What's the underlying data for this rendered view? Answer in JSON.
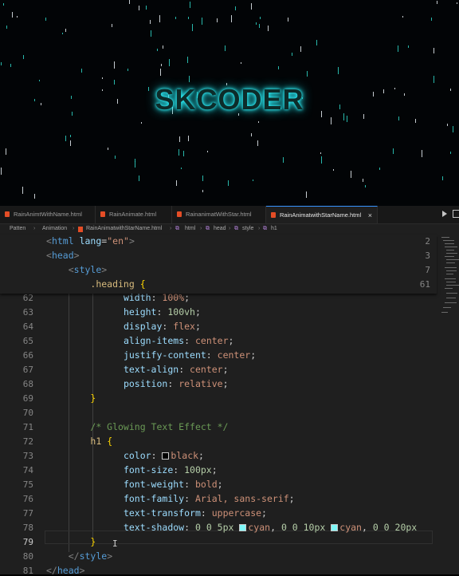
{
  "preview": {
    "brand_text": "SKCODER",
    "glow_color": "#2ff5ff"
  },
  "tabs": [
    {
      "label": "RainAnimtWithName.html",
      "active": false
    },
    {
      "label": "RainAnimate.html",
      "active": false
    },
    {
      "label": "RainanimatWithStar.html",
      "active": false
    },
    {
      "label": "RainAnimatwithStarName.html",
      "active": true,
      "close": "×"
    }
  ],
  "breadcrumb": [
    "Patten",
    "Animation",
    "RainAnimatwithStarName.html",
    "html",
    "head",
    "style",
    "h1"
  ],
  "sticky": [
    {
      "line": "2"
    },
    {
      "line": "3"
    },
    {
      "line": "7"
    },
    {
      "line": "61"
    }
  ],
  "lines": [
    "62",
    "63",
    "64",
    "65",
    "66",
    "67",
    "68",
    "69",
    "70",
    "71",
    "72",
    "73",
    "74",
    "75",
    "76",
    "77",
    "78",
    "79",
    "80",
    "81"
  ],
  "code": {
    "l2_lang": "en",
    "selector_heading": ".heading",
    "width_prop": "width",
    "width_val": "100%",
    "height_prop": "height",
    "height_val": "100vh",
    "display_prop": "display",
    "display_val": "flex",
    "align_prop": "align-items",
    "align_val": "center",
    "justify_prop": "justify-content",
    "justify_val": "center",
    "textalign_prop": "text-align",
    "textalign_val": "center",
    "position_prop": "position",
    "position_val": "relative",
    "comment": "/* Glowing Text Effect */",
    "selector_h1": "h1",
    "color_prop": "color",
    "color_val": "black",
    "fontsize_prop": "font-size",
    "fontsize_val": "100px",
    "fontweight_prop": "font-weight",
    "fontweight_val": "bold",
    "fontfamily_prop": "font-family",
    "fontfamily_val": "Arial, sans-serif",
    "transform_prop": "text-transform",
    "transform_val": "uppercase",
    "shadow_prop": "text-shadow",
    "shadow_a": "0 0 5px",
    "shadow_b": "0 0 10px",
    "shadow_c": "0 0 20px",
    "shadow_color": "cyan"
  },
  "colors": {
    "swatch_black": "#000000",
    "swatch_cyan": "#7ff7f7"
  }
}
